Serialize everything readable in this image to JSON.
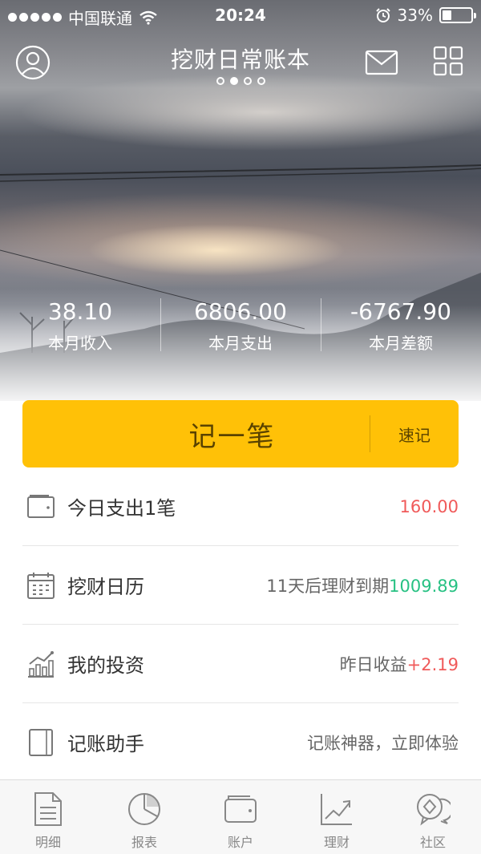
{
  "status_bar": {
    "carrier": "中国联通",
    "time": "20:24",
    "battery": "33%"
  },
  "header": {
    "title": "挖财日常账本",
    "page_indicator": {
      "total": 4,
      "active_index": 1
    }
  },
  "stats": [
    {
      "value": "38.10",
      "label": "本月收入"
    },
    {
      "value": "6806.00",
      "label": "本月支出"
    },
    {
      "value": "-6767.90",
      "label": "本月差额"
    }
  ],
  "record_button": {
    "label": "记一笔",
    "quick_label": "速记",
    "color": "#ffc107"
  },
  "list": [
    {
      "icon": "wallet-icon",
      "label": "今日支出1笔",
      "value_prefix": "",
      "value": "160.00",
      "value_color": "#f05a5a"
    },
    {
      "icon": "calendar-icon",
      "label": "挖财日历",
      "value_prefix": "11天后理财到期",
      "value": "1009.89",
      "value_color": "#27c183"
    },
    {
      "icon": "chart-icon",
      "label": "我的投资",
      "value_prefix": "昨日收益",
      "value": "+2.19",
      "value_color": "#f05a5a"
    },
    {
      "icon": "notebook-icon",
      "label": "记账助手",
      "value_prefix": "记账神器，立即体验",
      "value": "",
      "value_color": "#666666"
    }
  ],
  "tabs": [
    {
      "icon": "document-icon",
      "label": "明细"
    },
    {
      "icon": "pie-chart-icon",
      "label": "报表"
    },
    {
      "icon": "wallet-icon",
      "label": "账户"
    },
    {
      "icon": "trend-icon",
      "label": "理财"
    },
    {
      "icon": "community-icon",
      "label": "社区"
    }
  ]
}
